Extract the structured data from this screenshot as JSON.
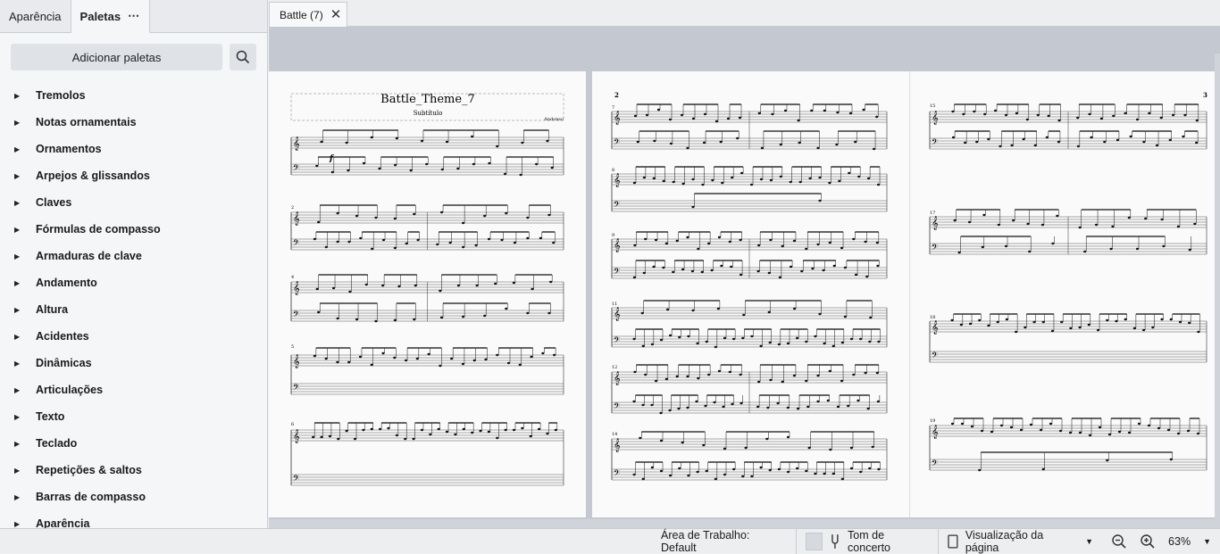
{
  "panel": {
    "tabs": [
      {
        "label": "Aparência"
      },
      {
        "label": "Paletas",
        "more": "⋯"
      }
    ],
    "add_palettes_label": "Adicionar paletas",
    "palettes": [
      {
        "label": "Tremolos"
      },
      {
        "label": "Notas ornamentais"
      },
      {
        "label": "Ornamentos"
      },
      {
        "label": "Arpejos & glissandos"
      },
      {
        "label": "Claves"
      },
      {
        "label": "Fórmulas de compasso"
      },
      {
        "label": "Armaduras de clave"
      },
      {
        "label": "Andamento"
      },
      {
        "label": "Altura"
      },
      {
        "label": "Acidentes"
      },
      {
        "label": "Dinâmicas"
      },
      {
        "label": "Articulações"
      },
      {
        "label": "Texto"
      },
      {
        "label": "Teclado"
      },
      {
        "label": "Repetições & saltos"
      },
      {
        "label": "Barras de compasso"
      },
      {
        "label": "Aparência"
      }
    ]
  },
  "document_tab": {
    "label": "Battle (7)",
    "close": "✕"
  },
  "score": {
    "title": "Battle_Theme_7",
    "subtitle": "Subtítulo",
    "composer": "Andonso",
    "dynamic": "f",
    "page2_number": "2",
    "page3_number": "3",
    "page1_measures": [
      "2",
      "4",
      "5",
      "6"
    ],
    "page2_measures": [
      "7",
      "8",
      "9",
      "11",
      "12",
      "14"
    ],
    "page3_measures": [
      "15",
      "17",
      "18",
      "19"
    ]
  },
  "status": {
    "workspace": "Área de Trabalho: Default",
    "concert_pitch": "Tom de concerto",
    "view_mode": "Visualização da página",
    "zoom": "63%"
  }
}
